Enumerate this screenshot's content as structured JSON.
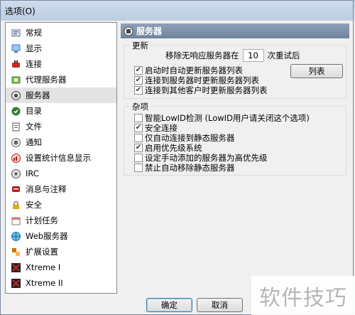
{
  "window": {
    "title": "选项(O)"
  },
  "sidebar": {
    "items": [
      {
        "label": "常规",
        "icon": "general-icon",
        "color": "#5b6f8c"
      },
      {
        "label": "显示",
        "icon": "display-icon",
        "color": "#3a7bd5"
      },
      {
        "label": "连接",
        "icon": "connection-icon",
        "color": "#c62828"
      },
      {
        "label": "代理服务器",
        "icon": "proxy-icon",
        "color": "#2e7d32"
      },
      {
        "label": "服务器",
        "icon": "server-icon",
        "color": "#444444"
      },
      {
        "label": "目录",
        "icon": "directory-icon",
        "color": "#2e7d32"
      },
      {
        "label": "文件",
        "icon": "files-icon",
        "color": "#555555"
      },
      {
        "label": "通知",
        "icon": "notify-icon",
        "color": "#666666"
      },
      {
        "label": "设置统计信息显示",
        "icon": "stats-icon",
        "color": "#b71c1c"
      },
      {
        "label": "IRC",
        "icon": "irc-icon",
        "color": "#555555"
      },
      {
        "label": "消息与注释",
        "icon": "messages-icon",
        "color": "#b71c1c"
      },
      {
        "label": "安全",
        "icon": "security-icon",
        "color": "#e0a800"
      },
      {
        "label": "计划任务",
        "icon": "scheduler-icon",
        "color": "#777777"
      },
      {
        "label": "Web服务器",
        "icon": "web-icon",
        "color": "#1976d2"
      },
      {
        "label": "扩展设置",
        "icon": "extended-icon",
        "color": "#c77800"
      },
      {
        "label": "Xtreme I",
        "icon": "xtreme-icon",
        "color": "#c62828"
      },
      {
        "label": "Xtreme II",
        "icon": "xtreme-icon",
        "color": "#c62828"
      }
    ],
    "selected_index": 4
  },
  "panel": {
    "title": "服务器",
    "update_group": {
      "title": "更新",
      "retry_prefix": "移除无响应服务器在",
      "retry_value": "10",
      "retry_suffix": "次重试后",
      "options": [
        {
          "label": "启动时自动更新服务器列表",
          "checked": true
        },
        {
          "label": "连接到服务器时更新服务器列表",
          "checked": true
        },
        {
          "label": "连接到其他客户时更新服务器列表",
          "checked": true
        }
      ],
      "list_button": "列表"
    },
    "misc_group": {
      "title": "杂项",
      "options": [
        {
          "label": "智能LowID检测 (LowID用户请关闭这个选项)",
          "checked": false
        },
        {
          "label": "安全连接",
          "checked": true
        },
        {
          "label": "仅自动连接到静态服务器",
          "checked": false
        },
        {
          "label": "启用优先级系统",
          "checked": true
        },
        {
          "label": "设定手动添加的服务器为高优先级",
          "checked": false
        },
        {
          "label": "禁止自动移除静态服务器",
          "checked": false
        }
      ]
    }
  },
  "footer": {
    "ok": "确定",
    "cancel": "取消"
  },
  "watermark": "软件技巧"
}
